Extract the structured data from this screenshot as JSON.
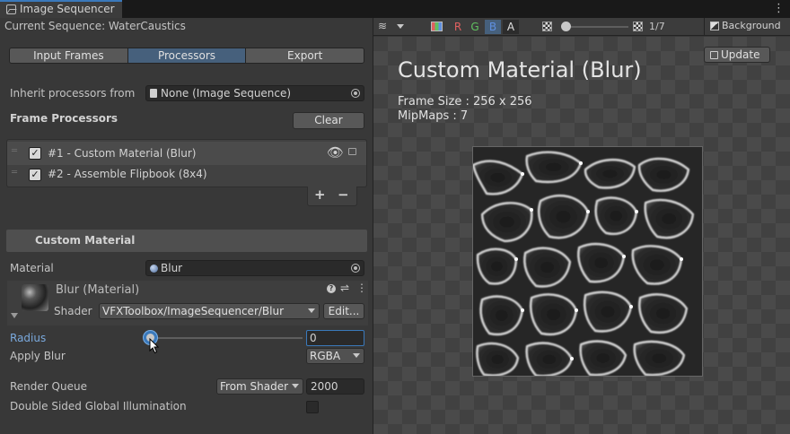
{
  "window": {
    "title": "Image Sequencer"
  },
  "sequence": {
    "label": "Current Sequence: WaterCaustics"
  },
  "tabs": [
    "Input Frames",
    "Processors",
    "Export"
  ],
  "inherit": {
    "label": "Inherit processors from",
    "value": "None (Image Sequence)"
  },
  "frame_processors": {
    "label": "Frame Processors",
    "clear_label": "Clear",
    "items": [
      "#1 - Custom Material (Blur)",
      "#2 - Assemble Flipbook (8x4)"
    ],
    "add": "+",
    "remove": "−"
  },
  "custom_material": {
    "header": "Custom Material",
    "material_label": "Material",
    "material_value": "Blur",
    "material_title": "Blur (Material)",
    "shader_label": "Shader",
    "shader_value": "VFXToolbox/ImageSequencer/Blur",
    "edit_label": "Edit...",
    "radius_label": "Radius",
    "radius_value": "0",
    "radius_fraction": 0,
    "apply_blur_label": "Apply Blur",
    "apply_blur_value": "RGBA",
    "render_queue_label": "Render Queue",
    "render_queue_mode": "From Shader",
    "render_queue_value": "2000",
    "dsgi_label": "Double Sided Global Illumination"
  },
  "toolbar": {
    "channels": [
      "R",
      "G",
      "B",
      "A"
    ],
    "channel_colors": {
      "R": "#e06060",
      "G": "#60c060",
      "B": "#6090e0",
      "A": "#e0e0e0"
    },
    "frame_counter": "1/7",
    "background_label": "Background"
  },
  "preview": {
    "title": "Custom Material (Blur)",
    "frame_size": "Frame Size : 256 x 256",
    "mipmaps": "MipMaps : 7",
    "update_label": "Update"
  },
  "colors": {
    "accent": "#3a79bb",
    "active_tab": "#46607c"
  }
}
